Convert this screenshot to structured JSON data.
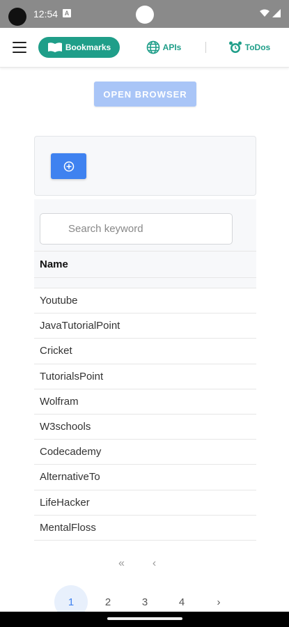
{
  "status_bar": {
    "time": "12:54",
    "notification_icon": "a-notification-icon",
    "letter": "A"
  },
  "nav": {
    "tabs": [
      {
        "label": "Bookmarks",
        "icon": "book-open-icon",
        "active": true
      },
      {
        "label": "APIs",
        "icon": "globe-icon",
        "active": false
      },
      {
        "label": "ToDos",
        "icon": "alarm-clock-icon",
        "active": false
      }
    ]
  },
  "open_browser_label": "OPEN BROWSER",
  "search": {
    "placeholder": "Search keyword",
    "value": ""
  },
  "table": {
    "column_header": "Name",
    "rows": [
      "Youtube",
      "JavaTutorialPoint",
      "Cricket",
      "TutorialsPoint",
      "Wolfram",
      "W3schools",
      "Codecademy",
      "AlternativeTo",
      "LifeHacker",
      "MentalFloss"
    ]
  },
  "pagination": {
    "first": "«",
    "prev": "‹",
    "pages": [
      "1",
      "2",
      "3",
      "4"
    ],
    "active_page": "1",
    "next": "›"
  },
  "colors": {
    "accent_teal": "#1f9e89",
    "primary_blue": "#3f82f0",
    "disabled_blue": "#a9c5f7"
  }
}
